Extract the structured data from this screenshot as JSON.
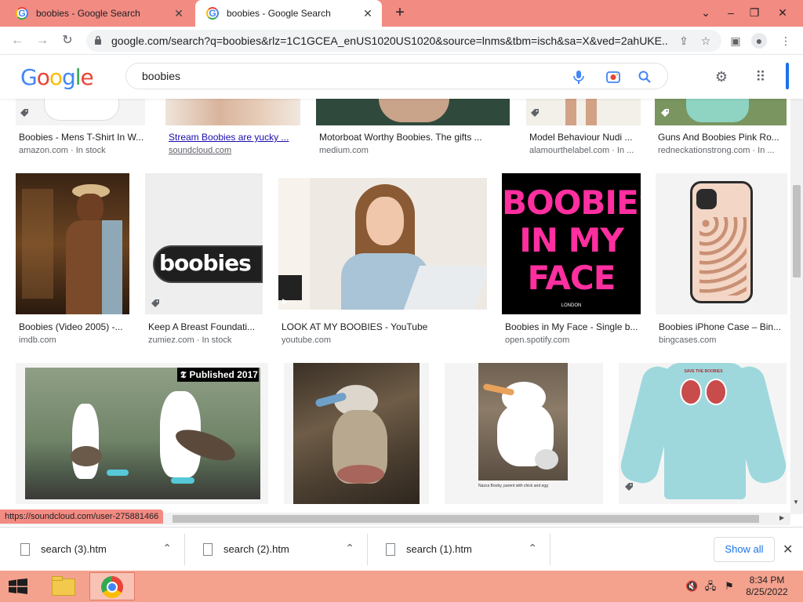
{
  "browser": {
    "tabs": [
      {
        "title": "boobies - Google Search",
        "active": false
      },
      {
        "title": "boobies - Google Search",
        "active": true
      }
    ],
    "url": "google.com/search?q=boobies&rlz=1C1GCEA_enUS1020US1020&source=lnms&tbm=isch&sa=X&ved=2ahUKE..."
  },
  "google": {
    "logo": "Google",
    "query": "boobies"
  },
  "results": {
    "row1": [
      {
        "caption": "Boobies - Mens T-Shirt In W...",
        "source": "amazon.com · In stock"
      },
      {
        "caption": "Stream Boobies are yucky ...",
        "source": "soundcloud.com"
      },
      {
        "caption": "Motorboat Worthy Boobies. The gifts ...",
        "source": "medium.com"
      },
      {
        "caption": "Model Behaviour Nudi ...",
        "source": "alamourthelabel.com · In ..."
      },
      {
        "caption": "Guns And Boobies Pink Ro...",
        "source": "redneckationstrong.com · In ..."
      }
    ],
    "row2": [
      {
        "caption": "Boobies (Video 2005) -...",
        "source": "imdb.com"
      },
      {
        "caption": "Keep A Breast Foundati...",
        "source": "zumiez.com · In stock",
        "thumb_text": "boobies"
      },
      {
        "caption": "LOOK AT MY BOOBIES - YouTube",
        "source": "youtube.com"
      },
      {
        "caption": "Boobies in My Face - Single b...",
        "source": "open.spotify.com",
        "art_lines": [
          "BOOBIES",
          "IN MY",
          "FACE"
        ],
        "art_small": "LONDON"
      },
      {
        "caption": "Boobies iPhone Case – Bin...",
        "source": "bingcases.com"
      }
    ],
    "row3": [
      {
        "badge": "Published 2017"
      },
      {},
      {
        "thumb_caption": "Nazca Booby, parent with chick and egg"
      },
      {
        "shirt_text": "SAVE THE BOOBIES"
      }
    ]
  },
  "status_url": "https://soundcloud.com/user-275881466",
  "downloads": {
    "items": [
      "search (3).htm",
      "search (2).htm",
      "search (1).htm"
    ],
    "show_all": "Show all"
  },
  "taskbar": {
    "time": "8:34 PM",
    "date": "8/25/2022"
  },
  "colors": {
    "tab_strip": "#f28b82",
    "taskbar": "#f4a28e",
    "link": "#1a0dab"
  }
}
